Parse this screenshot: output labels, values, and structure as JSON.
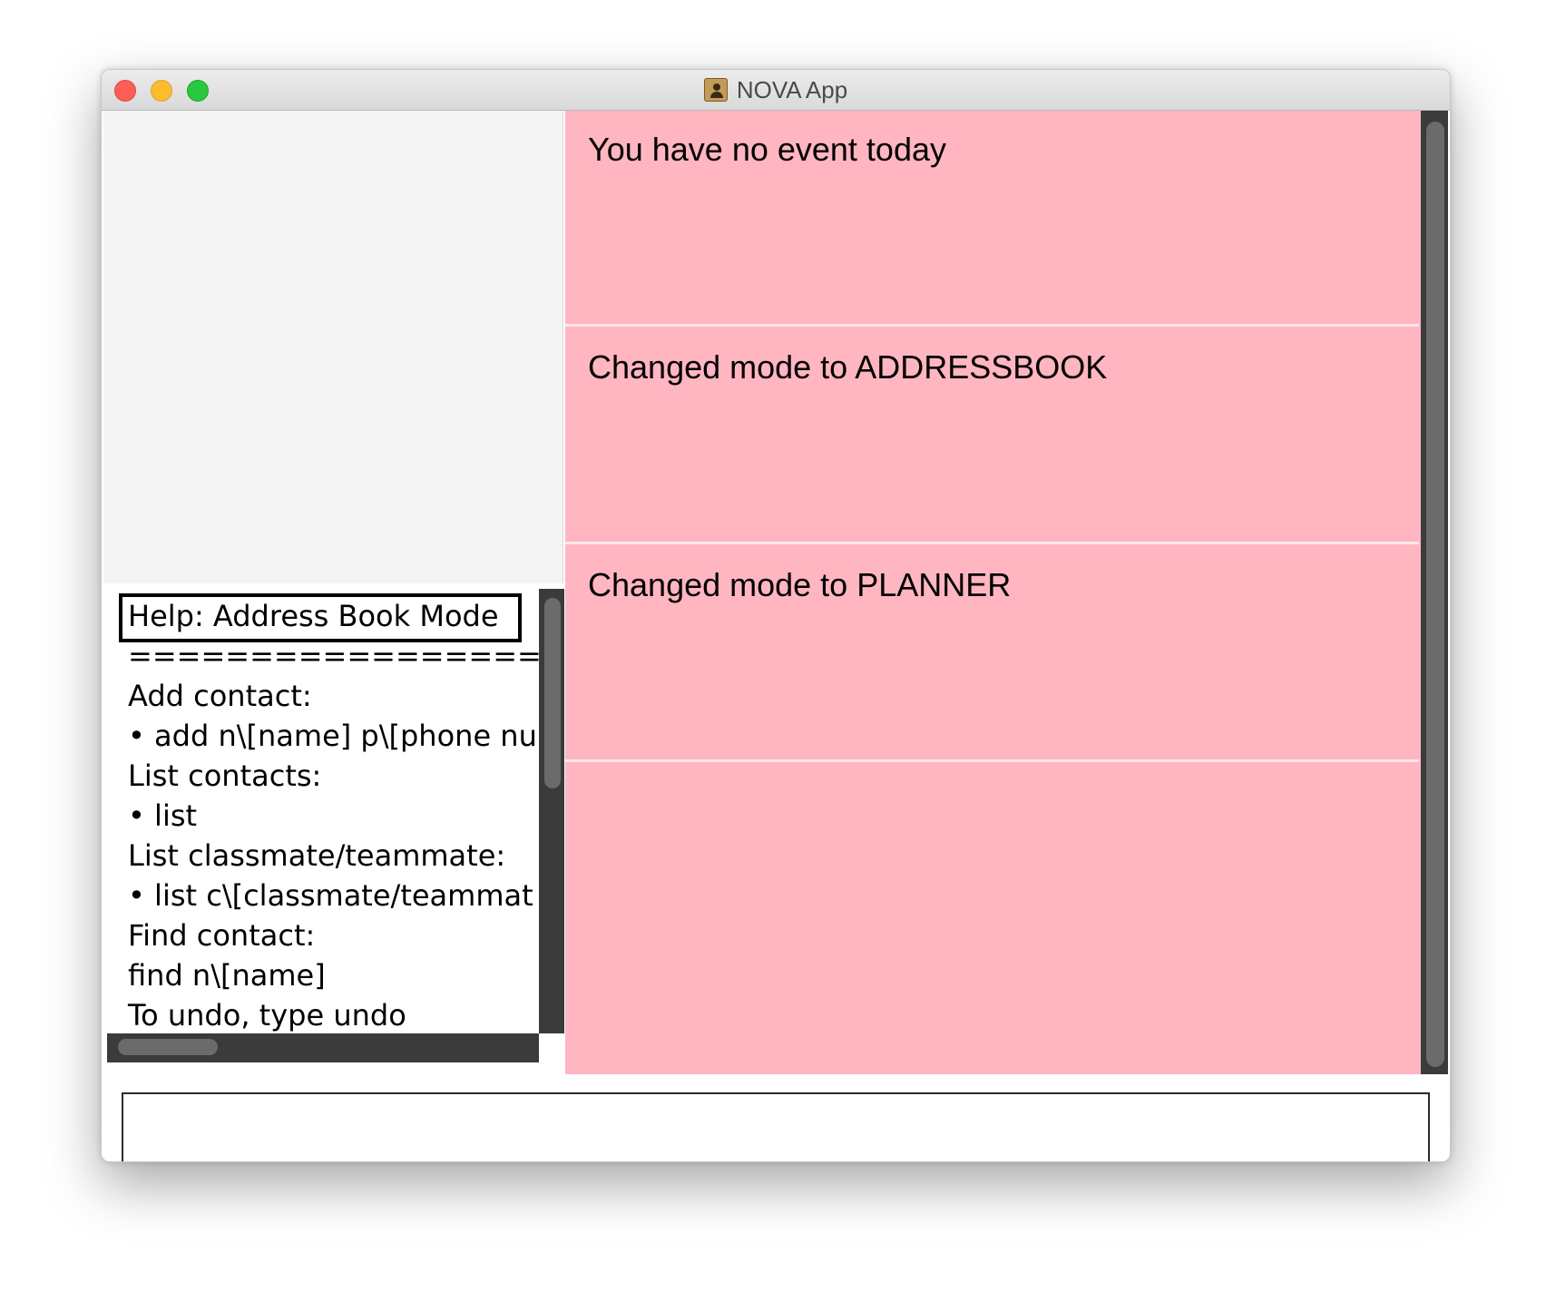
{
  "window": {
    "title": "NOVA App",
    "app_icon": "address-book-icon"
  },
  "help": {
    "title": "Help: Address Book Mode",
    "lines": [
      "===================",
      "Add contact:",
      "• add n\\[name] p\\[phone nu",
      "List contacts:",
      "• list",
      "List classmate/teammate:",
      "• list c\\[classmate/teammat",
      "Find contact:",
      "find n\\[name]",
      "To undo, type undo"
    ]
  },
  "events": [
    {
      "text": "You have no event today"
    },
    {
      "text": "Changed mode to ADDRESSBOOK"
    },
    {
      "text": "Changed mode to PLANNER"
    },
    {
      "text": ""
    }
  ],
  "command": {
    "value": "",
    "placeholder": ""
  },
  "colors": {
    "event_background": "#ffb6c1",
    "scrollbar": "#3b3b3b"
  }
}
